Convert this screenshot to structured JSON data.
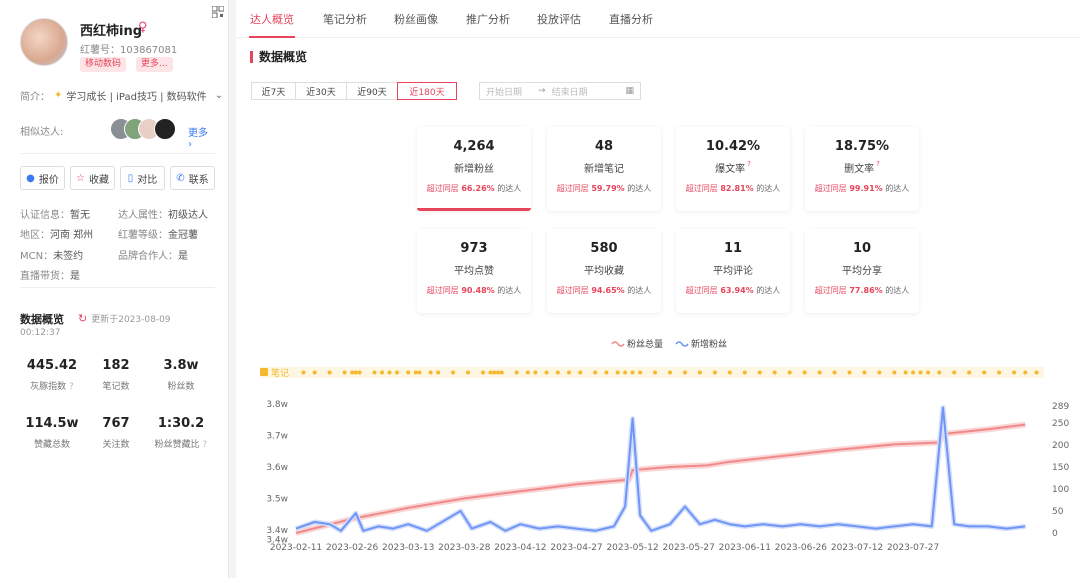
{
  "profile": {
    "name": "西红柿ing",
    "red_id": "红薯号：103867081",
    "tags": [
      "移动数码",
      "更多..."
    ],
    "intro_label": "简介：",
    "intro_text": "学习成长 | iPad技巧 | 数码软件",
    "similar_label": "相似达人:",
    "similar_more": "更多"
  },
  "actions": [
    "报价",
    "收藏",
    "对比",
    "联系"
  ],
  "info": [
    {
      "k": "认证信息：",
      "v": "暂无"
    },
    {
      "k": "达人属性：",
      "v": "初级达人"
    },
    {
      "k": "地区：",
      "v": "河南 郑州"
    },
    {
      "k": "红薯等级：",
      "v": "金冠薯"
    },
    {
      "k": "MCN：",
      "v": "未签约"
    },
    {
      "k": "品牌合作人：",
      "v": "是"
    },
    {
      "k": "直播带货：",
      "v": "是"
    }
  ],
  "overview_left": {
    "title": "数据概览",
    "updated": "更新于2023-08-09",
    "time": "00:12:37",
    "stats": [
      {
        "v": "445.42",
        "k": "灰豚指数"
      },
      {
        "v": "182",
        "k": "笔记数"
      },
      {
        "v": "3.8w",
        "k": "粉丝数"
      },
      {
        "v": "114.5w",
        "k": "赞藏总数"
      },
      {
        "v": "767",
        "k": "关注数"
      },
      {
        "v": "1:30.2",
        "k": "粉丝赞藏比"
      }
    ]
  },
  "tabs": [
    "达人概览",
    "笔记分析",
    "粉丝画像",
    "推广分析",
    "投放评估",
    "直播分析"
  ],
  "section_title": "数据概览",
  "ranges": [
    "近7天",
    "近30天",
    "近90天",
    "近180天"
  ],
  "date_start": "开始日期",
  "date_end": "结束日期",
  "cards": [
    {
      "v": "4,264",
      "k": "新增粉丝",
      "pre": "超过同层",
      "pct": "66.26%",
      "suf": "的达人"
    },
    {
      "v": "48",
      "k": "新增笔记",
      "pre": "超过同层",
      "pct": "59.79%",
      "suf": "的达人"
    },
    {
      "v": "10.42%",
      "k": "爆文率",
      "pre": "超过同层",
      "pct": "82.81%",
      "suf": "的达人"
    },
    {
      "v": "18.75%",
      "k": "删文率",
      "pre": "超过同层",
      "pct": "99.91%",
      "suf": "的达人"
    },
    {
      "v": "973",
      "k": "平均点赞",
      "pre": "超过同层",
      "pct": "90.48%",
      "suf": "的达人"
    },
    {
      "v": "580",
      "k": "平均收藏",
      "pre": "超过同层",
      "pct": "94.65%",
      "suf": "的达人"
    },
    {
      "v": "11",
      "k": "平均评论",
      "pre": "超过同层",
      "pct": "63.94%",
      "suf": "的达人"
    },
    {
      "v": "10",
      "k": "平均分享",
      "pre": "超过同层",
      "pct": "77.86%",
      "suf": "的达人"
    }
  ],
  "colors": {
    "accent": "#e6455b",
    "fans_total": "#f08a8a",
    "fans_new": "#6f95f5",
    "notes": "#f5b82e"
  },
  "chart_data": {
    "type": "line",
    "legend": [
      "粉丝总量",
      "新增粉丝"
    ],
    "notes_label": "笔记",
    "x_ticks": [
      "2023-02-11",
      "2023-02-26",
      "2023-03-13",
      "2023-03-28",
      "2023-04-12",
      "2023-04-27",
      "2023-05-12",
      "2023-05-27",
      "2023-06-11",
      "2023-06-26",
      "2023-07-12",
      "2023-07-27"
    ],
    "y_left_ticks": [
      "3.8w",
      "3.7w",
      "3.6w",
      "3.5w",
      "3.4w",
      "3.4w"
    ],
    "y_right_ticks": [
      "289",
      "250",
      "200",
      "150",
      "100",
      "50",
      "0"
    ],
    "fans_total": [
      [
        0,
        33900
      ],
      [
        15,
        34350
      ],
      [
        30,
        34700
      ],
      [
        45,
        35000
      ],
      [
        60,
        35230
      ],
      [
        75,
        35450
      ],
      [
        89,
        35600
      ],
      [
        90,
        35900
      ],
      [
        100,
        36000
      ],
      [
        110,
        36050
      ],
      [
        115,
        36150
      ],
      [
        130,
        36350
      ],
      [
        145,
        36550
      ],
      [
        160,
        36720
      ],
      [
        172,
        36780
      ],
      [
        173,
        37050
      ],
      [
        185,
        37200
      ],
      [
        195,
        37350
      ]
    ],
    "fans_new": [
      [
        0,
        10
      ],
      [
        5,
        25
      ],
      [
        9,
        20
      ],
      [
        12,
        5
      ],
      [
        16,
        45
      ],
      [
        18,
        5
      ],
      [
        22,
        15
      ],
      [
        26,
        10
      ],
      [
        30,
        20
      ],
      [
        35,
        5
      ],
      [
        40,
        30
      ],
      [
        44,
        50
      ],
      [
        47,
        10
      ],
      [
        52,
        25
      ],
      [
        56,
        5
      ],
      [
        60,
        20
      ],
      [
        65,
        10
      ],
      [
        70,
        15
      ],
      [
        75,
        10
      ],
      [
        80,
        5
      ],
      [
        85,
        15
      ],
      [
        88,
        60
      ],
      [
        90,
        260
      ],
      [
        92,
        40
      ],
      [
        95,
        5
      ],
      [
        100,
        20
      ],
      [
        104,
        60
      ],
      [
        108,
        20
      ],
      [
        112,
        30
      ],
      [
        116,
        20
      ],
      [
        120,
        15
      ],
      [
        125,
        20
      ],
      [
        130,
        15
      ],
      [
        135,
        20
      ],
      [
        140,
        15
      ],
      [
        145,
        20
      ],
      [
        150,
        15
      ],
      [
        155,
        10
      ],
      [
        160,
        15
      ],
      [
        165,
        20
      ],
      [
        170,
        15
      ],
      [
        173,
        285
      ],
      [
        176,
        20
      ],
      [
        180,
        15
      ],
      [
        185,
        15
      ],
      [
        190,
        10
      ],
      [
        195,
        15
      ]
    ],
    "notes_days": [
      2,
      5,
      9,
      13,
      15,
      16,
      17,
      21,
      23,
      25,
      27,
      30,
      32,
      33,
      36,
      38,
      42,
      46,
      50,
      52,
      53,
      54,
      55,
      59,
      62,
      64,
      67,
      70,
      73,
      76,
      80,
      83,
      86,
      88,
      90,
      92,
      96,
      100,
      104,
      108,
      112,
      116,
      120,
      124,
      128,
      132,
      136,
      140,
      144,
      148,
      152,
      156,
      160,
      163,
      165,
      167,
      169,
      172,
      176,
      180,
      184,
      188,
      192,
      195,
      198
    ],
    "fans_total_range": [
      33900,
      38100
    ],
    "fans_new_range": [
      0,
      300
    ],
    "x_range_days": [
      0,
      200
    ]
  }
}
